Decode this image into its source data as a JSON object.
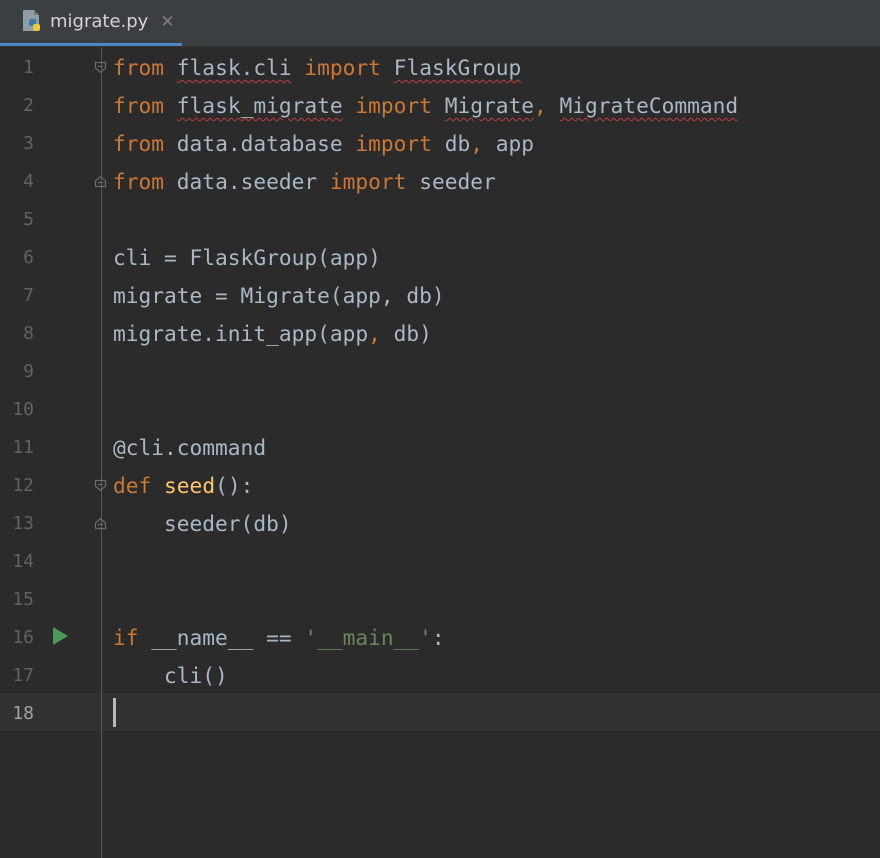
{
  "tab": {
    "filename": "migrate.py",
    "close_glyph": "✕",
    "icon": "python-file-icon"
  },
  "gutter": {
    "line_numbers": [
      "1",
      "2",
      "3",
      "4",
      "5",
      "6",
      "7",
      "8",
      "9",
      "10",
      "11",
      "12",
      "13",
      "14",
      "15",
      "16",
      "17",
      "18"
    ],
    "current_line": "18",
    "run_marker_line": "16"
  },
  "code": {
    "l1": {
      "kw1": "from",
      "mod": "flask.cli",
      "kw2": "import",
      "name": "FlaskGroup"
    },
    "l2": {
      "kw1": "from",
      "mod": "flask_migrate",
      "kw2": "import",
      "name1": "Migrate",
      "comma": ",",
      "name2": "MigrateCommand"
    },
    "l3": {
      "kw1": "from",
      "mod": "data.database",
      "kw2": "import",
      "name1": "db",
      "comma": ",",
      "name2": "app"
    },
    "l4": {
      "kw1": "from",
      "mod": "data.seeder",
      "kw2": "import",
      "name": "seeder"
    },
    "l6": {
      "text": "cli = FlaskGroup(app)"
    },
    "l7": {
      "text": "migrate = Migrate(app, db)"
    },
    "l8": {
      "pre": "migrate.init_app(app",
      "comma": ",",
      "post": " db)"
    },
    "l11": {
      "text": "@cli.command"
    },
    "l12": {
      "kw": "def",
      "fn": "seed",
      "post": "():"
    },
    "l13": {
      "text": "    seeder(db)"
    },
    "l16": {
      "kw": "if",
      "mid": " __name__ == ",
      "str": "'__main__'",
      "post": ":"
    },
    "l17": {
      "text": "    cli()"
    }
  },
  "colors": {
    "background": "#2b2b2b",
    "keyword": "#cc7832",
    "function": "#ffc66d",
    "string": "#6a8759",
    "default_text": "#a9b7c6",
    "run_marker": "#499c54",
    "tab_underline": "#4a88c7"
  }
}
